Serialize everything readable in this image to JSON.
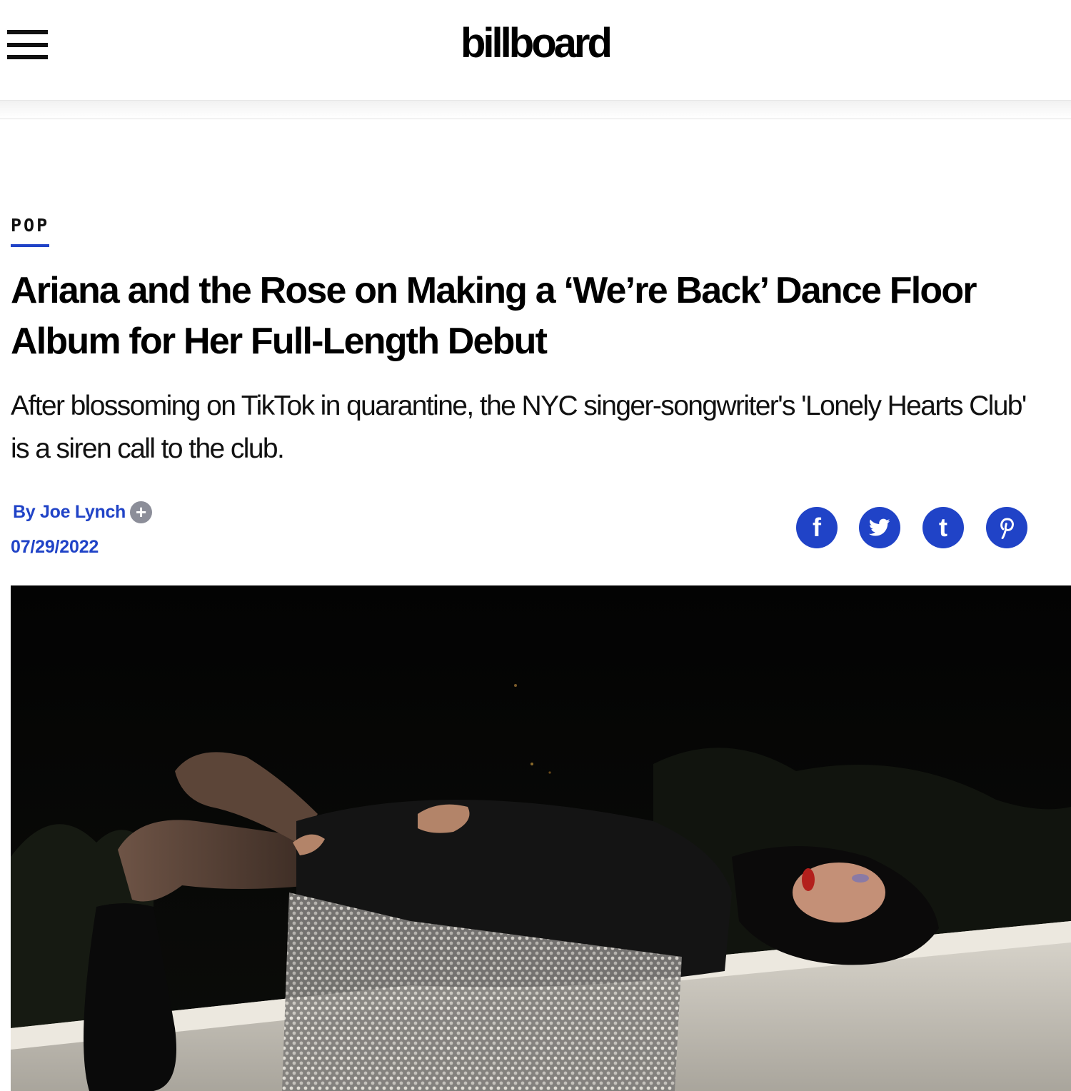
{
  "header": {
    "logo_text": "billboard",
    "menu_icon": "hamburger-menu-icon"
  },
  "article": {
    "category": "POP",
    "headline": "Ariana and the Rose on Making a ‘We’re Back’ Dance Floor Album for Her Full-Length Debut",
    "dek": "After blossoming on TikTok in quarantine, the NYC singer-songwriter's 'Lonely Hearts Club' is a siren call to the club.",
    "byline": "By Joe Lynch",
    "follow_symbol": "+",
    "date": "07/29/2022"
  },
  "share": {
    "facebook_glyph": "f",
    "tumblr_glyph": "t"
  },
  "colors": {
    "accent": "#2043c7",
    "follow_badge": "#8c8e99"
  }
}
